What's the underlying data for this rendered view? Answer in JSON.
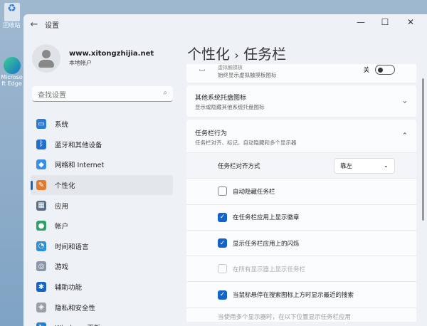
{
  "desktop": {
    "icons": [
      "回收站",
      "Microsoft Edge"
    ]
  },
  "window": {
    "title": "设置",
    "controls": [
      "—",
      "☐",
      "✕"
    ]
  },
  "profile": {
    "name": "www.xitongzhijia.net",
    "type": "本地帐户"
  },
  "search": {
    "placeholder": "查找设置"
  },
  "nav": [
    {
      "label": "系统",
      "color": "#2b7bd6",
      "glyph": "▭"
    },
    {
      "label": "蓝牙和其他设备",
      "color": "#1f6fd1",
      "glyph": "ᛒ"
    },
    {
      "label": "网络和 Internet",
      "color": "#3a8ee6",
      "glyph": "◆"
    },
    {
      "label": "个性化",
      "color": "#e07a2e",
      "glyph": "✎"
    },
    {
      "label": "应用",
      "color": "#5a6d86",
      "glyph": "▦"
    },
    {
      "label": "帐户",
      "color": "#2ea06a",
      "glyph": "●"
    },
    {
      "label": "时间和语言",
      "color": "#2b8fd6",
      "glyph": "◔"
    },
    {
      "label": "游戏",
      "color": "#8a96a6",
      "glyph": "◎"
    },
    {
      "label": "辅助功能",
      "color": "#1463c7",
      "glyph": "✱"
    },
    {
      "label": "隐私和安全性",
      "color": "#9aa0a8",
      "glyph": "◈"
    },
    {
      "label": "Windows 更新",
      "color": "#1f7fd6",
      "glyph": "↻"
    }
  ],
  "selected_nav": 3,
  "breadcrumb": {
    "parent": "个性化",
    "sep": "›",
    "current": "任务栏"
  },
  "touchpad": {
    "title": "虚拟触摸板",
    "subtitle": "始终显示虚拟触摸板图标",
    "state": "关"
  },
  "tray": {
    "title": "其他系统托盘图标",
    "subtitle": "显示或隐藏其他系统托盘图标"
  },
  "behavior": {
    "title": "任务栏行为",
    "subtitle": "任务栏对齐、标记、自动隐藏和多个显示器",
    "alignment_label": "任务栏对齐方式",
    "alignment_value": "靠左",
    "options": [
      {
        "label": "自动隐藏任务栏",
        "checked": false,
        "disabled": false
      },
      {
        "label": "在任务栏应用上显示徽章",
        "checked": true,
        "disabled": false
      },
      {
        "label": "显示任务栏应用上的闪烁",
        "checked": true,
        "disabled": false
      },
      {
        "label": "在所有显示器上显示任务栏",
        "checked": false,
        "disabled": true
      },
      {
        "label": "当鼠标悬停在搜索图标上方时显示最近的搜索",
        "checked": true,
        "disabled": false
      }
    ],
    "last_row": "当使用多个显示器时，在以下位置显示任务栏应用"
  }
}
